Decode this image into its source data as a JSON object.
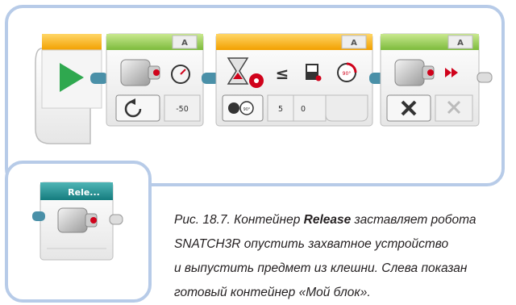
{
  "blocks": {
    "rotate_block": {
      "port": "A",
      "power": "-50"
    },
    "wait_block": {
      "port": "A",
      "compare": "≤",
      "threshold": "5",
      "value": "0"
    },
    "stop_block": {
      "port": "A"
    }
  },
  "my_block": {
    "title": "Rele..."
  },
  "caption": {
    "prefix": "Рис. 18.7. Контейнер ",
    "bold_word": "Release",
    "line1_rest": " заставляет робота",
    "line2": "SNATCH3R опустить захватное устройство",
    "line3": "и выпустить предмет из клешни. Слева показан",
    "line4": "готовый контейнер «Мой блок»."
  },
  "colors": {
    "frame": "#b7cbe8",
    "start_header": "#f2a900",
    "motor_header": "#88c34a",
    "wait_header": "#f2a900",
    "my_block_header": "#1f8a8c",
    "play_green": "#2fa84f"
  }
}
